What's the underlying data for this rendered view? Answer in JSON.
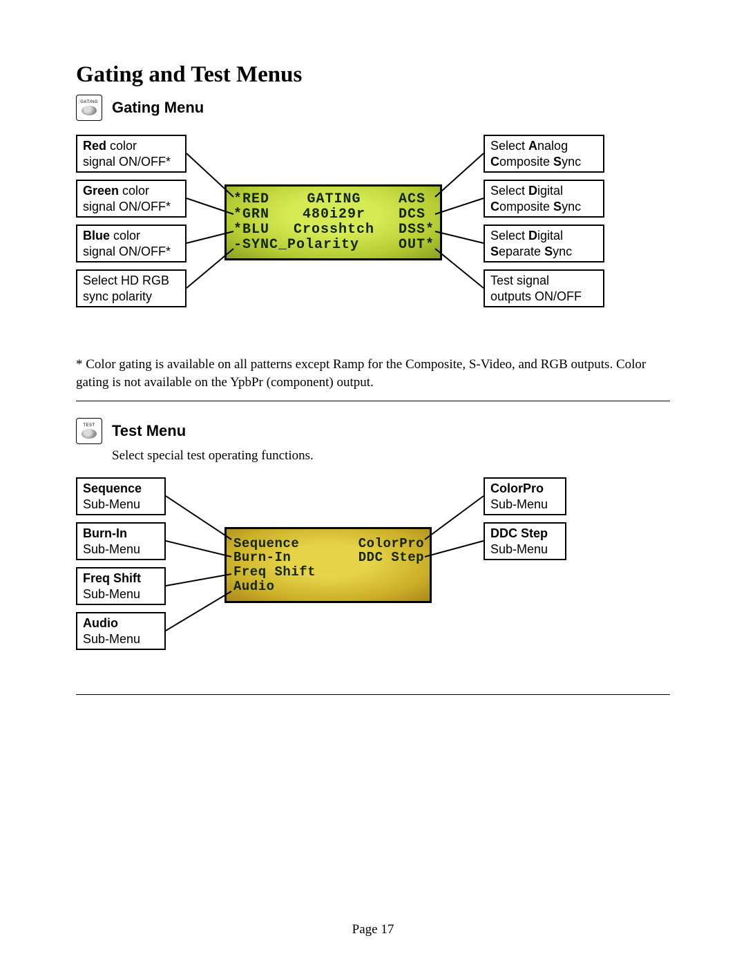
{
  "title": "Gating and Test Menus",
  "gating": {
    "button_label": "GATING",
    "heading": "Gating Menu",
    "callouts_left": {
      "red": {
        "bold": "Red",
        "rest": " color",
        "line2": "signal ON/OFF*"
      },
      "green": {
        "bold": "Green",
        "rest": " color",
        "line2": "signal ON/OFF*"
      },
      "blue": {
        "bold": "Blue",
        "rest": " color",
        "line2": "signal ON/OFF*"
      },
      "sync": {
        "line1": "Select HD RGB",
        "line2": "sync polarity"
      }
    },
    "callouts_right": {
      "acs": {
        "line1_a": "Select ",
        "line1_b": "A",
        "line1_c": "nalog",
        "line2_a": "C",
        "line2_b": "omposite ",
        "line2_c": "S",
        "line2_d": "ync"
      },
      "dcs": {
        "line1_a": "Select ",
        "line1_b": "D",
        "line1_c": "igital",
        "line2_a": "C",
        "line2_b": "omposite ",
        "line2_c": "S",
        "line2_d": "ync"
      },
      "dss": {
        "line1_a": "Select ",
        "line1_b": "D",
        "line1_c": "igital",
        "line2_a": "S",
        "line2_b": "eparate ",
        "line2_c": "S",
        "line2_d": "ync"
      },
      "out": {
        "line1": "Test signal",
        "line2": "outputs ON/OFF"
      }
    },
    "lcd_rows": [
      {
        "left": "*RED",
        "mid": "GATING",
        "right": "ACS "
      },
      {
        "left": "*GRN",
        "mid": "480i29r",
        "right": "DCS "
      },
      {
        "left": "*BLU",
        "mid": "Crosshtch",
        "right": "DSS*"
      },
      {
        "left": "-SYNC_Polarity",
        "mid": "",
        "right": "OUT*"
      }
    ],
    "footnote": "* Color gating is available on all patterns except Ramp for the Composite, S-Video, and RGB outputs. Color gating is not available on the YpbPr (component) output."
  },
  "test": {
    "button_label": "TEST",
    "heading": "Test Menu",
    "caption": "Select special test operating functions.",
    "callouts_left": {
      "sequence": {
        "bold": "Sequence",
        "line2": "Sub-Menu"
      },
      "burnin": {
        "bold": "Burn-In",
        "line2": "Sub-Menu"
      },
      "freqshift": {
        "bold": "Freq Shift",
        "line2": "Sub-Menu"
      },
      "audio": {
        "bold": "Audio",
        "line2": "Sub-Menu"
      }
    },
    "callouts_right": {
      "colorpro": {
        "bold": "ColorPro",
        "line2": "Sub-Menu"
      },
      "ddcstep": {
        "bold": "DDC Step",
        "line2": "Sub-Menu"
      }
    },
    "lcd_rows": [
      {
        "left": "Sequence",
        "right": "ColorPro"
      },
      {
        "left": "Burn-In",
        "right": "DDC Step"
      },
      {
        "left": "Freq Shift",
        "right": ""
      },
      {
        "left": "Audio",
        "right": ""
      }
    ]
  },
  "page_number": "Page 17"
}
